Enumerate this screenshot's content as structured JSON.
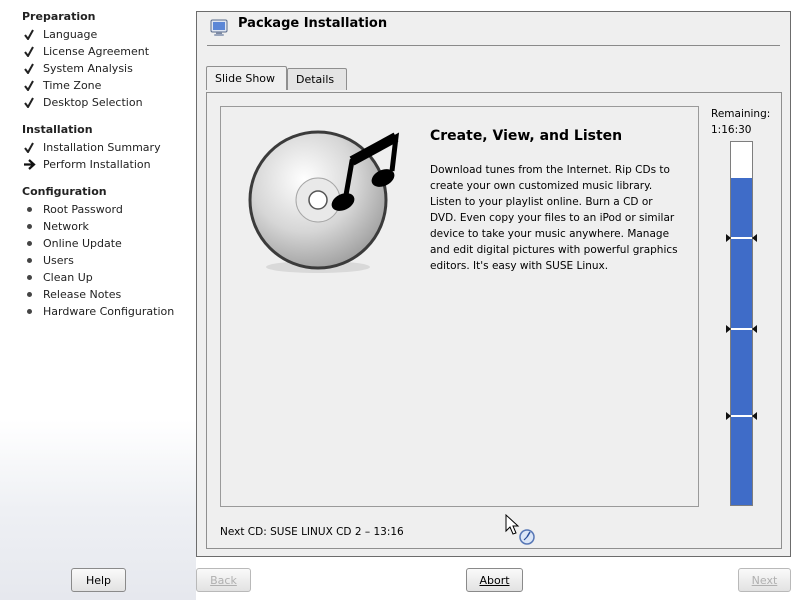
{
  "sidebar": {
    "sections": [
      {
        "title": "Preparation",
        "steps": [
          {
            "label": "Language",
            "state": "done"
          },
          {
            "label": "License Agreement",
            "state": "done"
          },
          {
            "label": "System Analysis",
            "state": "done"
          },
          {
            "label": "Time Zone",
            "state": "done"
          },
          {
            "label": "Desktop Selection",
            "state": "done"
          }
        ]
      },
      {
        "title": "Installation",
        "steps": [
          {
            "label": "Installation Summary",
            "state": "done"
          },
          {
            "label": "Perform Installation",
            "state": "current"
          }
        ]
      },
      {
        "title": "Configuration",
        "steps": [
          {
            "label": "Root Password",
            "state": "pending"
          },
          {
            "label": "Network",
            "state": "pending"
          },
          {
            "label": "Online Update",
            "state": "pending"
          },
          {
            "label": "Users",
            "state": "pending"
          },
          {
            "label": "Clean Up",
            "state": "pending"
          },
          {
            "label": "Release Notes",
            "state": "pending"
          },
          {
            "label": "Hardware Configuration",
            "state": "pending"
          }
        ]
      }
    ]
  },
  "header": {
    "title": "Package Installation",
    "icon": "monitor-install-icon"
  },
  "tabs": [
    {
      "label": "Slide Show",
      "active": true
    },
    {
      "label": "Details",
      "active": false
    }
  ],
  "slide": {
    "title": "Create, View, and Listen",
    "body": "Download tunes from the Internet. Rip CDs to create your own customized music library. Listen to your playlist online. Burn a CD or DVD. Even copy your files to an iPod or similar device to take your music anywhere. Manage and edit digital pictures with powerful graphics editors. It's easy with SUSE Linux.",
    "image": "cd-music-note-icon"
  },
  "status": {
    "next_cd": "Next CD: SUSE LINUX CD 2 – 13:16"
  },
  "progress": {
    "remaining_label": "Remaining:",
    "remaining_time": "1:16:30",
    "fill_fraction": 0.9,
    "cd_dividers": [
      0.26,
      0.51,
      0.75
    ],
    "fill_color": "#3f6cc8"
  },
  "buttons": {
    "help": "Help",
    "back": "Back",
    "abort": "Abort",
    "next": "Next"
  }
}
